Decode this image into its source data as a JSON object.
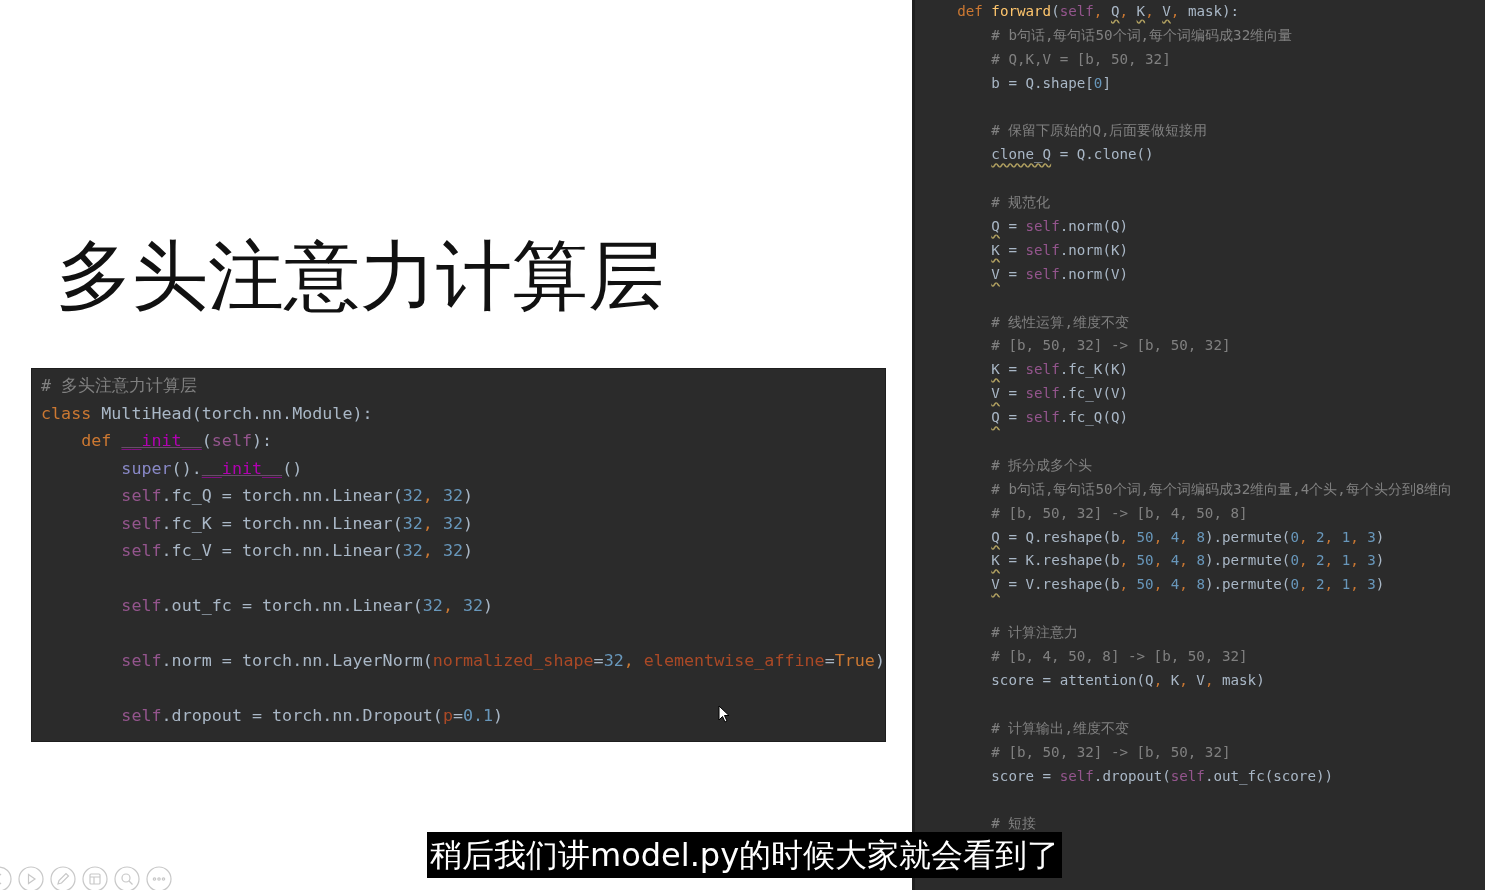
{
  "slide": {
    "title": "多头注意力计算层",
    "code_lines": [
      {
        "tokens": [
          {
            "kind": "c",
            "text": "# 多头注意力计算层"
          }
        ]
      },
      {
        "tokens": [
          {
            "kind": "kw",
            "text": "class "
          },
          {
            "kind": "p",
            "text": "MultiHead(torch.nn.Module):"
          }
        ]
      },
      {
        "tokens": [
          {
            "kind": "kw",
            "text": "    def "
          },
          {
            "kind": "du",
            "text": "__init__"
          },
          {
            "kind": "p",
            "text": "("
          },
          {
            "kind": "self",
            "text": "self"
          },
          {
            "kind": "p",
            "text": "):"
          }
        ]
      },
      {
        "tokens": [
          {
            "kind": "bi",
            "text": "        super"
          },
          {
            "kind": "p",
            "text": "()."
          },
          {
            "kind": "du",
            "text": "__init__"
          },
          {
            "kind": "p",
            "text": "()"
          }
        ]
      },
      {
        "tokens": [
          {
            "kind": "self",
            "text": "        self"
          },
          {
            "kind": "p",
            "text": ".fc_Q = torch.nn.Linear("
          },
          {
            "kind": "n",
            "text": "32"
          },
          {
            "kind": "kw",
            "text": ", "
          },
          {
            "kind": "n",
            "text": "32"
          },
          {
            "kind": "p",
            "text": ")"
          }
        ]
      },
      {
        "tokens": [
          {
            "kind": "self",
            "text": "        self"
          },
          {
            "kind": "p",
            "text": ".fc_K = torch.nn.Linear("
          },
          {
            "kind": "n",
            "text": "32"
          },
          {
            "kind": "kw",
            "text": ", "
          },
          {
            "kind": "n",
            "text": "32"
          },
          {
            "kind": "p",
            "text": ")"
          }
        ]
      },
      {
        "tokens": [
          {
            "kind": "self",
            "text": "        self"
          },
          {
            "kind": "p",
            "text": ".fc_V = torch.nn.Linear("
          },
          {
            "kind": "n",
            "text": "32"
          },
          {
            "kind": "kw",
            "text": ", "
          },
          {
            "kind": "n",
            "text": "32"
          },
          {
            "kind": "p",
            "text": ")"
          }
        ]
      },
      {
        "blank_before": true,
        "tokens": [
          {
            "kind": "self",
            "text": "        self"
          },
          {
            "kind": "p",
            "text": ".out_fc = torch.nn.Linear("
          },
          {
            "kind": "n",
            "text": "32"
          },
          {
            "kind": "kw",
            "text": ", "
          },
          {
            "kind": "n",
            "text": "32"
          },
          {
            "kind": "p",
            "text": ")"
          }
        ]
      },
      {
        "blank_before": true,
        "tokens": [
          {
            "kind": "self",
            "text": "        self"
          },
          {
            "kind": "p",
            "text": ".norm = torch.nn.LayerNorm("
          },
          {
            "kind": "pa",
            "text": "normalized_shape"
          },
          {
            "kind": "p",
            "text": "="
          },
          {
            "kind": "n",
            "text": "32"
          },
          {
            "kind": "kw",
            "text": ", "
          },
          {
            "kind": "pa",
            "text": "elementwise_affine"
          },
          {
            "kind": "p",
            "text": "="
          },
          {
            "kind": "kw",
            "text": "True"
          },
          {
            "kind": "p",
            "text": ")"
          }
        ]
      },
      {
        "blank_before": true,
        "tokens": [
          {
            "kind": "self",
            "text": "        self"
          },
          {
            "kind": "p",
            "text": ".dropout = torch.nn.Dropout("
          },
          {
            "kind": "pa",
            "text": "p"
          },
          {
            "kind": "p",
            "text": "="
          },
          {
            "kind": "n",
            "text": "0.1"
          },
          {
            "kind": "p",
            "text": ")"
          }
        ]
      }
    ]
  },
  "editor": {
    "code_lines": [
      {
        "tokens": [
          {
            "kind": "kw",
            "text": "    def "
          },
          {
            "kind": "fn",
            "text": "forward"
          },
          {
            "kind": "p",
            "text": "("
          },
          {
            "kind": "self",
            "text": "self"
          },
          {
            "kind": "kw",
            "text": ", "
          },
          {
            "kind": "w",
            "text": "Q"
          },
          {
            "kind": "kw",
            "text": ", "
          },
          {
            "kind": "w",
            "text": "K"
          },
          {
            "kind": "kw",
            "text": ", "
          },
          {
            "kind": "w",
            "text": "V"
          },
          {
            "kind": "kw",
            "text": ", "
          },
          {
            "kind": "p",
            "text": "mask):"
          }
        ]
      },
      {
        "tokens": [
          {
            "kind": "c",
            "text": "        # b句话,每句话50个词,每个词编码成32维向量"
          }
        ]
      },
      {
        "tokens": [
          {
            "kind": "c",
            "text": "        # Q,K,V = [b, 50, 32]"
          }
        ]
      },
      {
        "tokens": [
          {
            "kind": "p",
            "text": "        b = Q.shape["
          },
          {
            "kind": "n",
            "text": "0"
          },
          {
            "kind": "p",
            "text": "]"
          }
        ]
      },
      {
        "blank_before": true,
        "tokens": [
          {
            "kind": "c",
            "text": "        # 保留下原始的Q,后面要做短接用"
          }
        ]
      },
      {
        "tokens": [
          {
            "kind": "w",
            "text": "        clone_Q"
          },
          {
            "kind": "p",
            "text": " = Q.clone()"
          }
        ]
      },
      {
        "blank_before": true,
        "tokens": [
          {
            "kind": "c",
            "text": "        # 规范化"
          }
        ]
      },
      {
        "tokens": [
          {
            "kind": "w",
            "text": "        Q"
          },
          {
            "kind": "p",
            "text": " = "
          },
          {
            "kind": "self",
            "text": "self"
          },
          {
            "kind": "p",
            "text": ".norm(Q)"
          }
        ]
      },
      {
        "tokens": [
          {
            "kind": "w",
            "text": "        K"
          },
          {
            "kind": "p",
            "text": " = "
          },
          {
            "kind": "self",
            "text": "self"
          },
          {
            "kind": "p",
            "text": ".norm(K)"
          }
        ]
      },
      {
        "tokens": [
          {
            "kind": "w",
            "text": "        V"
          },
          {
            "kind": "p",
            "text": " = "
          },
          {
            "kind": "self",
            "text": "self"
          },
          {
            "kind": "p",
            "text": ".norm(V)"
          }
        ]
      },
      {
        "blank_before": true,
        "tokens": [
          {
            "kind": "c",
            "text": "        # 线性运算,维度不变"
          }
        ]
      },
      {
        "tokens": [
          {
            "kind": "c",
            "text": "        # [b, 50, 32] -> [b, 50, 32]"
          }
        ]
      },
      {
        "tokens": [
          {
            "kind": "w",
            "text": "        K"
          },
          {
            "kind": "p",
            "text": " = "
          },
          {
            "kind": "self",
            "text": "self"
          },
          {
            "kind": "p",
            "text": ".fc_K(K)"
          }
        ]
      },
      {
        "tokens": [
          {
            "kind": "w",
            "text": "        V"
          },
          {
            "kind": "p",
            "text": " = "
          },
          {
            "kind": "self",
            "text": "self"
          },
          {
            "kind": "p",
            "text": ".fc_V(V)"
          }
        ]
      },
      {
        "tokens": [
          {
            "kind": "w",
            "text": "        Q"
          },
          {
            "kind": "p",
            "text": " = "
          },
          {
            "kind": "self",
            "text": "self"
          },
          {
            "kind": "p",
            "text": ".fc_Q(Q)"
          }
        ]
      },
      {
        "blank_before": true,
        "tokens": [
          {
            "kind": "c",
            "text": "        # 拆分成多个头"
          }
        ]
      },
      {
        "tokens": [
          {
            "kind": "c",
            "text": "        # b句话,每句话50个词,每个词编码成32维向量,4个头,每个头分到8维向"
          }
        ]
      },
      {
        "tokens": [
          {
            "kind": "c",
            "text": "        # [b, 50, 32] -> [b, 4, 50, 8]"
          }
        ]
      },
      {
        "tokens": [
          {
            "kind": "w",
            "text": "        Q"
          },
          {
            "kind": "p",
            "text": " = Q.reshape(b"
          },
          {
            "kind": "kw",
            "text": ", "
          },
          {
            "kind": "n",
            "text": "50"
          },
          {
            "kind": "kw",
            "text": ", "
          },
          {
            "kind": "n",
            "text": "4"
          },
          {
            "kind": "kw",
            "text": ", "
          },
          {
            "kind": "n",
            "text": "8"
          },
          {
            "kind": "p",
            "text": ").permute("
          },
          {
            "kind": "n",
            "text": "0"
          },
          {
            "kind": "kw",
            "text": ", "
          },
          {
            "kind": "n",
            "text": "2"
          },
          {
            "kind": "kw",
            "text": ", "
          },
          {
            "kind": "n",
            "text": "1"
          },
          {
            "kind": "kw",
            "text": ", "
          },
          {
            "kind": "n",
            "text": "3"
          },
          {
            "kind": "p",
            "text": ")"
          }
        ]
      },
      {
        "tokens": [
          {
            "kind": "w",
            "text": "        K"
          },
          {
            "kind": "p",
            "text": " = K.reshape(b"
          },
          {
            "kind": "kw",
            "text": ", "
          },
          {
            "kind": "n",
            "text": "50"
          },
          {
            "kind": "kw",
            "text": ", "
          },
          {
            "kind": "n",
            "text": "4"
          },
          {
            "kind": "kw",
            "text": ", "
          },
          {
            "kind": "n",
            "text": "8"
          },
          {
            "kind": "p",
            "text": ").permute("
          },
          {
            "kind": "n",
            "text": "0"
          },
          {
            "kind": "kw",
            "text": ", "
          },
          {
            "kind": "n",
            "text": "2"
          },
          {
            "kind": "kw",
            "text": ", "
          },
          {
            "kind": "n",
            "text": "1"
          },
          {
            "kind": "kw",
            "text": ", "
          },
          {
            "kind": "n",
            "text": "3"
          },
          {
            "kind": "p",
            "text": ")"
          }
        ]
      },
      {
        "tokens": [
          {
            "kind": "w",
            "text": "        V"
          },
          {
            "kind": "p",
            "text": " = V.reshape(b"
          },
          {
            "kind": "kw",
            "text": ", "
          },
          {
            "kind": "n",
            "text": "50"
          },
          {
            "kind": "kw",
            "text": ", "
          },
          {
            "kind": "n",
            "text": "4"
          },
          {
            "kind": "kw",
            "text": ", "
          },
          {
            "kind": "n",
            "text": "8"
          },
          {
            "kind": "p",
            "text": ").permute("
          },
          {
            "kind": "n",
            "text": "0"
          },
          {
            "kind": "kw",
            "text": ", "
          },
          {
            "kind": "n",
            "text": "2"
          },
          {
            "kind": "kw",
            "text": ", "
          },
          {
            "kind": "n",
            "text": "1"
          },
          {
            "kind": "kw",
            "text": ", "
          },
          {
            "kind": "n",
            "text": "3"
          },
          {
            "kind": "p",
            "text": ")"
          }
        ]
      },
      {
        "blank_before": true,
        "tokens": [
          {
            "kind": "c",
            "text": "        # 计算注意力"
          }
        ]
      },
      {
        "tokens": [
          {
            "kind": "c",
            "text": "        # [b, 4, 50, 8] -> [b, 50, 32]"
          }
        ]
      },
      {
        "tokens": [
          {
            "kind": "p",
            "text": "        score = attention(Q"
          },
          {
            "kind": "kw",
            "text": ", "
          },
          {
            "kind": "p",
            "text": "K"
          },
          {
            "kind": "kw",
            "text": ", "
          },
          {
            "kind": "p",
            "text": "V"
          },
          {
            "kind": "kw",
            "text": ", "
          },
          {
            "kind": "p",
            "text": "mask)"
          }
        ]
      },
      {
        "blank_before": true,
        "tokens": [
          {
            "kind": "c",
            "text": "        # 计算输出,维度不变"
          }
        ]
      },
      {
        "tokens": [
          {
            "kind": "c",
            "text": "        # [b, 50, 32] -> [b, 50, 32]"
          }
        ]
      },
      {
        "tokens": [
          {
            "kind": "p",
            "text": "        score = "
          },
          {
            "kind": "self",
            "text": "self"
          },
          {
            "kind": "p",
            "text": ".dropout("
          },
          {
            "kind": "self",
            "text": "self"
          },
          {
            "kind": "p",
            "text": ".out_fc(score))"
          }
        ]
      },
      {
        "blank_before": true,
        "tokens": [
          {
            "kind": "c",
            "text": "        # 短接"
          }
        ]
      }
    ]
  },
  "subtitle": "稍后我们讲model.py的时候大家就会看到了"
}
